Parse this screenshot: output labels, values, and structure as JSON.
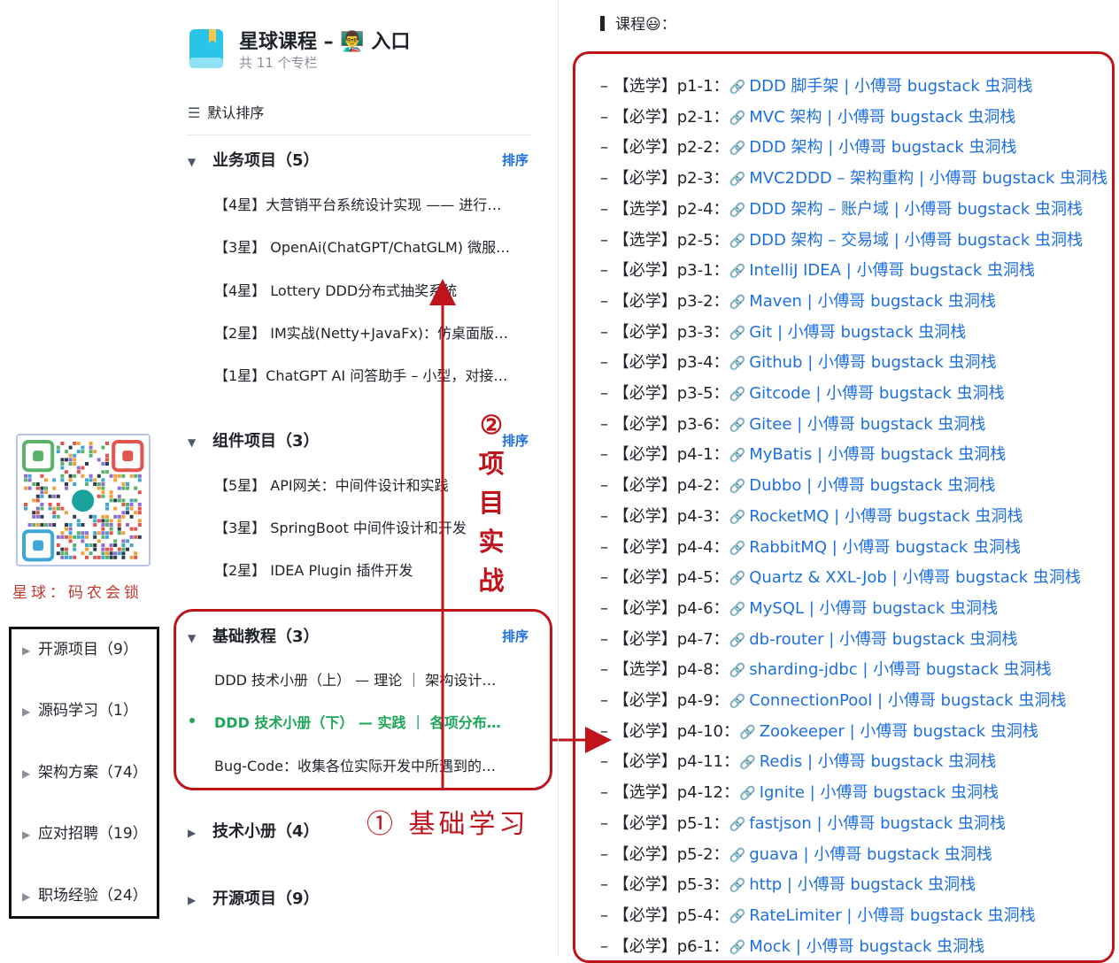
{
  "qr": {
    "caption": "星球：码农会锁"
  },
  "sidebar": {
    "items": [
      {
        "label": "开源项目（9）"
      },
      {
        "label": "源码学习（1）"
      },
      {
        "label": "架构方案（74）"
      },
      {
        "label": "应对招聘（19）"
      },
      {
        "label": "职场经验（24）"
      }
    ]
  },
  "catalog": {
    "title": "星球课程 – 👨‍🏫 入口",
    "subtitle": "共 11 个专栏",
    "sort_label": "默认排序",
    "sections": [
      {
        "title": "业务项目（5）",
        "sort": "排序",
        "items": [
          "【4星】大营销平台系统设计实现 —— 进行…",
          "【3星】 OpenAi(ChatGPT/ChatGLM) 微服…",
          "【4星】 Lottery DDD分布式抽奖系统",
          "【2星】 IM实战(Netty+JavaFx)：仿桌面版…",
          "【1星】ChatGPT AI 问答助手 – 小型，对接…"
        ]
      },
      {
        "title": "组件项目（3）",
        "sort": "排序",
        "items": [
          "【5星】 API网关：中间件设计和实践",
          "【3星】 SpringBoot 中间件设计和开发",
          "【2星】 IDEA Plugin 插件开发"
        ]
      },
      {
        "title": "基础教程（3）",
        "sort": "排序",
        "items": [
          "DDD 技术小册（上） — 理论 ｜ 架构设计…",
          "DDD 技术小册（下） — 实践 ｜ 各项分布…",
          "Bug-Code：收集各位实际开发中所遇到的…"
        ],
        "active_index": 1
      },
      {
        "title": "技术小册（4）"
      },
      {
        "title": "开源项目（9）"
      }
    ]
  },
  "annotations": {
    "step1": "① 基础学习",
    "step2": [
      "②",
      "项",
      "目",
      "实",
      "战"
    ]
  },
  "courses": {
    "label": "课程😃：",
    "items": [
      {
        "prefix": "– 【选学】p1-1：",
        "link": "DDD 脚手架 | 小傅哥 bugstack 虫洞栈"
      },
      {
        "prefix": "– 【必学】p2-1：",
        "link": "MVC 架构 | 小傅哥 bugstack 虫洞栈"
      },
      {
        "prefix": "– 【必学】p2-2：",
        "link": "DDD 架构 | 小傅哥 bugstack 虫洞栈"
      },
      {
        "prefix": "– 【必学】p2-3：",
        "link": "MVC2DDD – 架构重构 | 小傅哥 bugstack 虫洞栈"
      },
      {
        "prefix": "– 【选学】p2-4：",
        "link": "DDD 架构 – 账户域 | 小傅哥 bugstack 虫洞栈"
      },
      {
        "prefix": "– 【选学】p2-5：",
        "link": "DDD 架构 – 交易域 | 小傅哥 bugstack 虫洞栈"
      },
      {
        "prefix": "– 【必学】p3-1：",
        "link": "IntelliJ IDEA | 小傅哥 bugstack 虫洞栈"
      },
      {
        "prefix": "– 【必学】p3-2：",
        "link": "Maven | 小傅哥 bugstack 虫洞栈"
      },
      {
        "prefix": "– 【必学】p3-3：",
        "link": "Git | 小傅哥 bugstack 虫洞栈"
      },
      {
        "prefix": "– 【必学】p3-4：",
        "link": "Github | 小傅哥 bugstack 虫洞栈"
      },
      {
        "prefix": "– 【必学】p3-5：",
        "link": "Gitcode | 小傅哥 bugstack 虫洞栈"
      },
      {
        "prefix": "– 【必学】p3-6：",
        "link": "Gitee | 小傅哥 bugstack 虫洞栈"
      },
      {
        "prefix": "– 【必学】p4-1：",
        "link": "MyBatis | 小傅哥 bugstack 虫洞栈"
      },
      {
        "prefix": "– 【必学】p4-2：",
        "link": "Dubbo | 小傅哥 bugstack 虫洞栈"
      },
      {
        "prefix": "– 【必学】p4-3：",
        "link": "RocketMQ | 小傅哥 bugstack 虫洞栈"
      },
      {
        "prefix": "– 【必学】p4-4：",
        "link": "RabbitMQ | 小傅哥 bugstack 虫洞栈"
      },
      {
        "prefix": "– 【必学】p4-5：",
        "link": "Quartz & XXL-Job | 小傅哥 bugstack 虫洞栈"
      },
      {
        "prefix": "– 【必学】p4-6：",
        "link": "MySQL | 小傅哥 bugstack 虫洞栈"
      },
      {
        "prefix": "– 【必学】p4-7：",
        "link": "db-router | 小傅哥 bugstack 虫洞栈"
      },
      {
        "prefix": "– 【选学】p4-8：",
        "link": "sharding-jdbc | 小傅哥 bugstack 虫洞栈"
      },
      {
        "prefix": "– 【必学】p4-9：",
        "link": "ConnectionPool | 小傅哥 bugstack 虫洞栈"
      },
      {
        "prefix": "– 【必学】p4-10：",
        "link": "Zookeeper | 小傅哥 bugstack 虫洞栈"
      },
      {
        "prefix": "– 【必学】p4-11：",
        "link": "Redis | 小傅哥 bugstack 虫洞栈"
      },
      {
        "prefix": "– 【选学】p4-12：",
        "link": "Ignite | 小傅哥 bugstack 虫洞栈"
      },
      {
        "prefix": "– 【必学】p5-1：",
        "link": "fastjson | 小傅哥 bugstack 虫洞栈"
      },
      {
        "prefix": "– 【必学】p5-2：",
        "link": "guava | 小傅哥 bugstack 虫洞栈"
      },
      {
        "prefix": "– 【必学】p5-3：",
        "link": "http | 小傅哥 bugstack 虫洞栈"
      },
      {
        "prefix": "– 【必学】p5-4：",
        "link": "RateLimiter | 小傅哥 bugstack 虫洞栈"
      },
      {
        "prefix": "– 【必学】p6-1：",
        "link": "Mock | 小傅哥 bugstack 虫洞栈"
      }
    ]
  },
  "colors": {
    "accent": "#1e6fe0",
    "annotation": "#c0141c",
    "active": "#1ea55a"
  }
}
